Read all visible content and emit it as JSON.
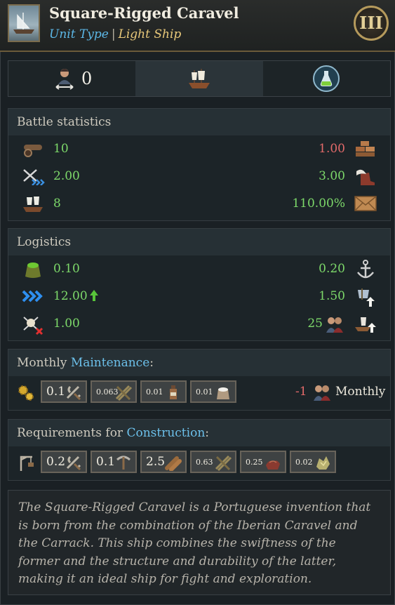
{
  "header": {
    "title": "Square-Rigged Caravel",
    "unit_type_label": "Unit Type",
    "separator": "|",
    "unit_class": "Light Ship",
    "tier": "III"
  },
  "tabs": {
    "crew_value": "0"
  },
  "battle": {
    "heading": "Battle statistics",
    "rows": [
      {
        "left": "10",
        "right": "1.00",
        "right_color": "red",
        "left_icon": "cannon-icon",
        "right_icon": "bricks-icon"
      },
      {
        "left": "2.00",
        "right": "3.00",
        "right_color": "green",
        "left_icon": "swords-speed-icon",
        "right_icon": "winged-boot-icon"
      },
      {
        "left": "8",
        "right": "110.00%",
        "right_color": "green",
        "left_icon": "ship-cannon-icon",
        "right_icon": "envelope-icon"
      }
    ]
  },
  "logistics": {
    "heading": "Logistics",
    "rows": [
      {
        "left": "0.10",
        "right": "0.20",
        "left_icon": "supply-sack-icon",
        "right_icon": "anchor-icon"
      },
      {
        "left": "12.00",
        "right": "1.50",
        "left_icon": "speed-chevrons-icon",
        "right_icon": "sail-up-icon",
        "up_arrow": true
      },
      {
        "left": "1.00",
        "right": "25",
        "left_icon": "pirate-skull-icon",
        "right_icon": "ship-up-icon",
        "right_mid_icon": "crew-icon"
      }
    ]
  },
  "maintenance": {
    "heading_prefix": "Monthly ",
    "heading_link": "Maintenance",
    "heading_suffix": ":",
    "costs": [
      {
        "amount": "0.1",
        "icon": "tools-icon"
      },
      {
        "amount": "0.063",
        "icon": "planks-icon"
      },
      {
        "amount": "0.01",
        "icon": "bottle-icon"
      },
      {
        "amount": "0.01",
        "icon": "salt-sack-icon"
      }
    ],
    "crew_delta": "-1",
    "monthly_label": "Monthly"
  },
  "construction": {
    "heading_prefix": "Requirements for ",
    "heading_link": "Construction",
    "heading_suffix": ":",
    "costs": [
      {
        "amount": "0.2",
        "icon": "tools-icon"
      },
      {
        "amount": "0.1",
        "icon": "pickaxe-icon"
      },
      {
        "amount": "2.5",
        "icon": "logs-icon"
      },
      {
        "amount": "0.63",
        "icon": "planks-icon"
      },
      {
        "amount": "0.25",
        "icon": "cloth-icon"
      },
      {
        "amount": "0.02",
        "icon": "ore-icon"
      }
    ]
  },
  "description": "The Square-Rigged Caravel is a Portuguese invention that is born from the combination of the Iberian Caravel and the Carrack. This ship combines the swiftness of the former and the structure and durability of the latter, making it an ideal ship for fight and exploration.",
  "colors": {
    "positive": "#7dd96a",
    "negative": "#e36a6a",
    "link": "#6cc0ea",
    "gold": "#e9c97a"
  }
}
